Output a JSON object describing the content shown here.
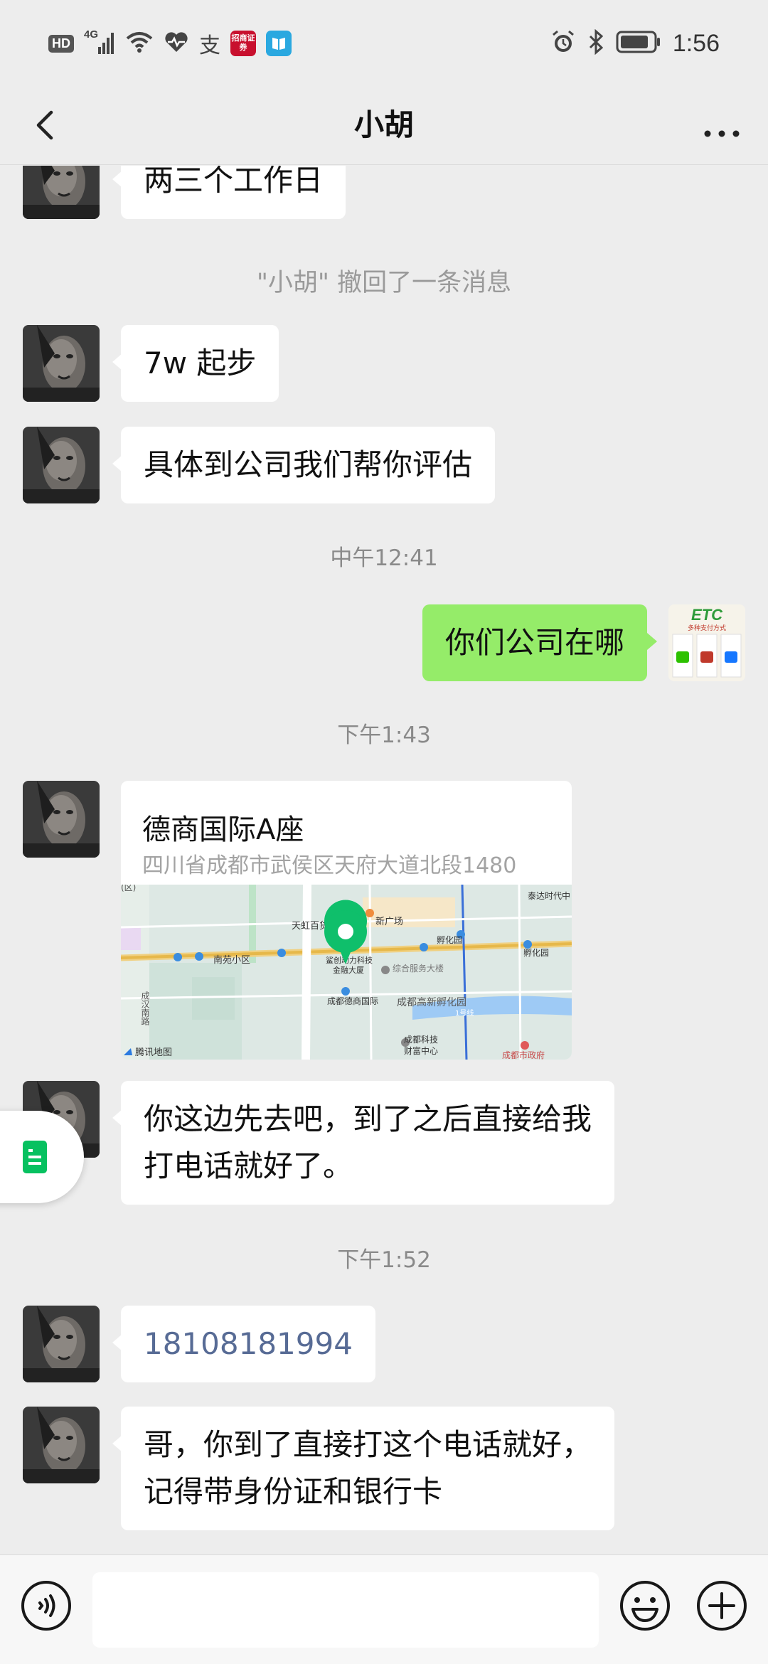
{
  "status_bar": {
    "hd": "HD",
    "network": "4G",
    "app_badge": "招商证券",
    "time": "1:56"
  },
  "header": {
    "title": "小胡",
    "back_icon": "chevron-left-icon",
    "more_icon": "more-horizontal-icon"
  },
  "messages": {
    "m1": "两三个工作日",
    "recall": "\"小胡\" 撤回了一条消息",
    "m2": "7w 起步",
    "m3": "具体到公司我们帮你评估",
    "ts1": "中午12:41",
    "m4": "你们公司在哪",
    "ts2": "下午1:43",
    "location": {
      "title": "德商国际A座",
      "address": "四川省成都市武侯区天府大道北段1480",
      "map_labels": [
        "天虹百货",
        "新广场",
        "泰达时代中",
        "孵化园",
        "南苑小区",
        "鲨创动力科技",
        "金融大厦",
        "综合服务大楼",
        "成都德商国际",
        "成都高新孵化园",
        "成汉南路",
        "1号线",
        "成都科技",
        "财富中心",
        "成都市政府",
        "孵化园",
        "腾讯地图"
      ]
    },
    "m5_line1": "你这边先去吧，到了之后直接给我",
    "m5_line2": "打电话就好了。",
    "ts3": "下午1:52",
    "m6": "18108181994",
    "m7_line1": "哥，你到了直接打这个电话就好，",
    "m7_line2": "记得带身份证和银行卡"
  },
  "my_avatar": {
    "brand": "ETC",
    "caption": "多种支付方式"
  },
  "input_bar": {
    "voice_icon": "voice-icon",
    "placeholder": "",
    "emoji_icon": "emoji-icon",
    "plus_icon": "plus-icon"
  },
  "colors": {
    "background": "#ededed",
    "my_bubble": "#95ec69",
    "their_bubble": "#ffffff",
    "phone_link": "#576b95",
    "accent": "#07c160"
  }
}
